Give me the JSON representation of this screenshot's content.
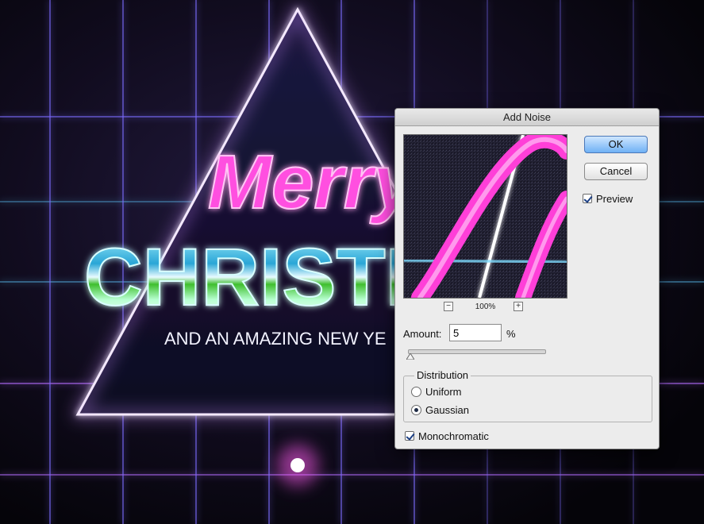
{
  "artwork": {
    "headline_script": "Merry",
    "headline_main": "CHRISTM",
    "tagline": "AND AN AMAZING NEW YE"
  },
  "dialog": {
    "title": "Add Noise",
    "ok_label": "OK",
    "cancel_label": "Cancel",
    "preview_label": "Preview",
    "preview_checked": true,
    "zoom_level": "100%",
    "zoom_out_symbol": "−",
    "zoom_in_symbol": "+",
    "amount_label": "Amount:",
    "amount_value": "5",
    "amount_unit": "%",
    "distribution": {
      "title": "Distribution",
      "options": [
        "Uniform",
        "Gaussian"
      ],
      "selected": "Gaussian"
    },
    "monochromatic_label": "Monochromatic",
    "monochromatic_checked": true
  },
  "icons": {
    "zoom_out": "minus-icon",
    "zoom_in": "plus-icon",
    "slider_thumb": "triangle-thumb-icon"
  },
  "colors": {
    "ok_button": "#6fb1f5",
    "neon_pink": "#ff3fd8",
    "neon_blue": "#5ec8ff",
    "grid_purple": "#7b6cff"
  }
}
